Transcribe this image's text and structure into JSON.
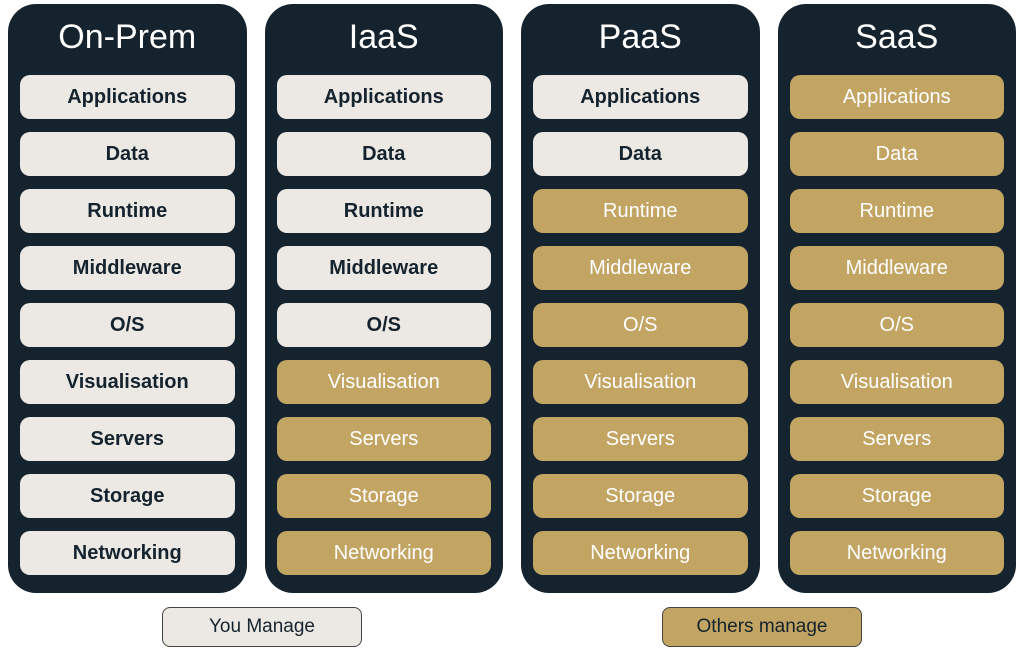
{
  "columns": [
    {
      "title": "On-Prem",
      "layers": [
        {
          "label": "Applications",
          "managed": "you"
        },
        {
          "label": "Data",
          "managed": "you"
        },
        {
          "label": "Runtime",
          "managed": "you"
        },
        {
          "label": "Middleware",
          "managed": "you"
        },
        {
          "label": "O/S",
          "managed": "you"
        },
        {
          "label": "Visualisation",
          "managed": "you"
        },
        {
          "label": "Servers",
          "managed": "you"
        },
        {
          "label": "Storage",
          "managed": "you"
        },
        {
          "label": "Networking",
          "managed": "you"
        }
      ]
    },
    {
      "title": "IaaS",
      "layers": [
        {
          "label": "Applications",
          "managed": "you"
        },
        {
          "label": "Data",
          "managed": "you"
        },
        {
          "label": "Runtime",
          "managed": "you"
        },
        {
          "label": "Middleware",
          "managed": "you"
        },
        {
          "label": "O/S",
          "managed": "you"
        },
        {
          "label": "Visualisation",
          "managed": "others"
        },
        {
          "label": "Servers",
          "managed": "others"
        },
        {
          "label": "Storage",
          "managed": "others"
        },
        {
          "label": "Networking",
          "managed": "others"
        }
      ]
    },
    {
      "title": "PaaS",
      "layers": [
        {
          "label": "Applications",
          "managed": "you"
        },
        {
          "label": "Data",
          "managed": "you"
        },
        {
          "label": "Runtime",
          "managed": "others"
        },
        {
          "label": "Middleware",
          "managed": "others"
        },
        {
          "label": "O/S",
          "managed": "others"
        },
        {
          "label": "Visualisation",
          "managed": "others"
        },
        {
          "label": "Servers",
          "managed": "others"
        },
        {
          "label": "Storage",
          "managed": "others"
        },
        {
          "label": "Networking",
          "managed": "others"
        }
      ]
    },
    {
      "title": "SaaS",
      "layers": [
        {
          "label": "Applications",
          "managed": "others"
        },
        {
          "label": "Data",
          "managed": "others"
        },
        {
          "label": "Runtime",
          "managed": "others"
        },
        {
          "label": "Middleware",
          "managed": "others"
        },
        {
          "label": "O/S",
          "managed": "others"
        },
        {
          "label": "Visualisation",
          "managed": "others"
        },
        {
          "label": "Servers",
          "managed": "others"
        },
        {
          "label": "Storage",
          "managed": "others"
        },
        {
          "label": "Networking",
          "managed": "others"
        }
      ]
    }
  ],
  "legend": {
    "you": "You Manage",
    "others": "Others manage"
  }
}
